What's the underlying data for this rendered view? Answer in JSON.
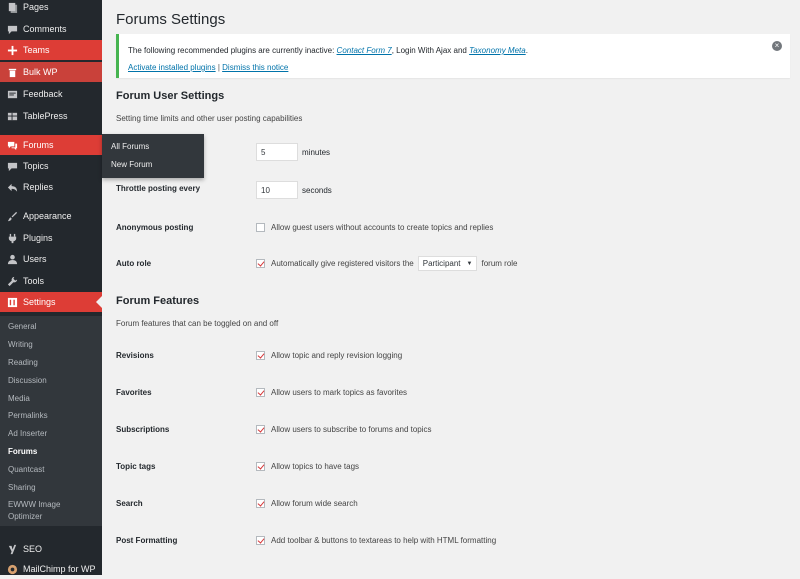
{
  "sidebar": {
    "items": [
      {
        "id": "pages",
        "label": "Pages",
        "icon": "pages-icon"
      },
      {
        "id": "comments",
        "label": "Comments",
        "icon": "comments-icon"
      },
      {
        "id": "teams",
        "label": "Teams",
        "icon": "plus-icon"
      },
      {
        "id": "bulkwp",
        "label": "Bulk WP",
        "icon": "trash-icon"
      },
      {
        "id": "feedback",
        "label": "Feedback",
        "icon": "feedback-icon"
      },
      {
        "id": "tablepress",
        "label": "TablePress",
        "icon": "table-icon"
      },
      {
        "id": "forums",
        "label": "Forums",
        "icon": "forums-icon"
      },
      {
        "id": "topics",
        "label": "Topics",
        "icon": "topics-icon"
      },
      {
        "id": "replies",
        "label": "Replies",
        "icon": "replies-icon"
      },
      {
        "id": "appearance",
        "label": "Appearance",
        "icon": "brush-icon"
      },
      {
        "id": "plugins",
        "label": "Plugins",
        "icon": "plug-icon"
      },
      {
        "id": "users",
        "label": "Users",
        "icon": "user-icon"
      },
      {
        "id": "tools",
        "label": "Tools",
        "icon": "wrench-icon"
      },
      {
        "id": "settings",
        "label": "Settings",
        "icon": "settings-icon"
      }
    ],
    "submenu": [
      "General",
      "Writing",
      "Reading",
      "Discussion",
      "Media",
      "Permalinks",
      "Ad Inserter",
      "Forums",
      "Quantcast",
      "Sharing",
      "EWWW Image",
      "Optimizer"
    ],
    "bottom": [
      {
        "id": "seo",
        "label": "SEO",
        "icon": "yoast-icon"
      },
      {
        "id": "mailchimp",
        "label": "MailChimp for WP",
        "icon": "mailchimp-icon"
      }
    ]
  },
  "flyout": {
    "items": [
      "All Forums",
      "New Forum"
    ]
  },
  "page": {
    "title": "Forums Settings"
  },
  "notice": {
    "prefix": "The following recommended plugins are currently inactive: ",
    "plugin1": "Contact Form 7",
    "sep1": ", Login With Ajax and ",
    "plugin2": "Taxonomy Meta",
    "suffix": ".",
    "activate": "Activate installed plugins",
    "divider": " | ",
    "dismiss_link": "Dismiss this notice",
    "close": "×"
  },
  "user_settings": {
    "heading": "Forum User Settings",
    "desc": "Setting time limits and other user posting capabilities",
    "edit_value": "5",
    "edit_unit": "minutes",
    "throttle_label": "Throttle posting every",
    "throttle_value": "10",
    "throttle_unit": "seconds",
    "anon_label": "Anonymous posting",
    "anon_text": "Allow guest users without accounts to create topics and replies",
    "autorole_label": "Auto role",
    "autorole_pre": "Automatically give registered visitors the",
    "autorole_select": "Participant",
    "autorole_post": "forum role"
  },
  "features": {
    "heading": "Forum Features",
    "desc": "Forum features that can be toggled on and off",
    "rows": [
      {
        "label": "Revisions",
        "text": "Allow topic and reply revision logging",
        "checked": true
      },
      {
        "label": "Favorites",
        "text": "Allow users to mark topics as favorites",
        "checked": true
      },
      {
        "label": "Subscriptions",
        "text": "Allow users to subscribe to forums and topics",
        "checked": true
      },
      {
        "label": "Topic tags",
        "text": "Allow topics to have tags",
        "checked": true
      },
      {
        "label": "Search",
        "text": "Allow forum wide search",
        "checked": true
      },
      {
        "label": "Post Formatting",
        "text": "Add toolbar & buttons to textareas to help with HTML formatting",
        "checked": true
      }
    ]
  }
}
